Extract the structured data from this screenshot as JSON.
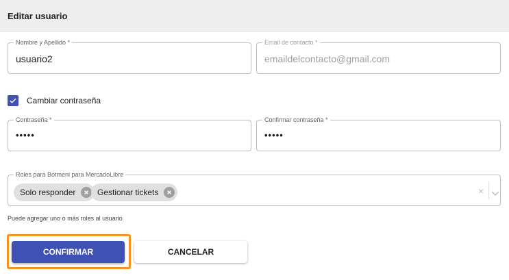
{
  "header": {
    "title": "Editar usuario"
  },
  "form": {
    "name": {
      "label": "Nombre y Apellido *",
      "value": "usuario2"
    },
    "email": {
      "label": "Email de contacto *",
      "placeholder": "emaildelcontacto@gmail.com"
    },
    "change_password": {
      "label": "Cambiar contraseña",
      "checked": true
    },
    "password": {
      "label": "Contraseña *",
      "value": "•••••"
    },
    "confirm_password": {
      "label": "Confirmar contraseña *",
      "value": "•••••"
    },
    "roles": {
      "label": "Roles para Botmeni para MercadoLibre",
      "chips": [
        "Solo responder",
        "Gestionar tickets"
      ],
      "clear_symbol": "×",
      "helper": "Puede agregar uno o más roles al usuario"
    }
  },
  "actions": {
    "confirm_label": "CONFIRMAR",
    "cancel_label": "CANCELAR"
  },
  "colors": {
    "primary": "#3f51b5",
    "highlight": "#f7931e"
  },
  "icons": {
    "checkbox": "check-icon",
    "chip_remove": "close-circle-icon",
    "dropdown": "chevron-down-icon"
  }
}
